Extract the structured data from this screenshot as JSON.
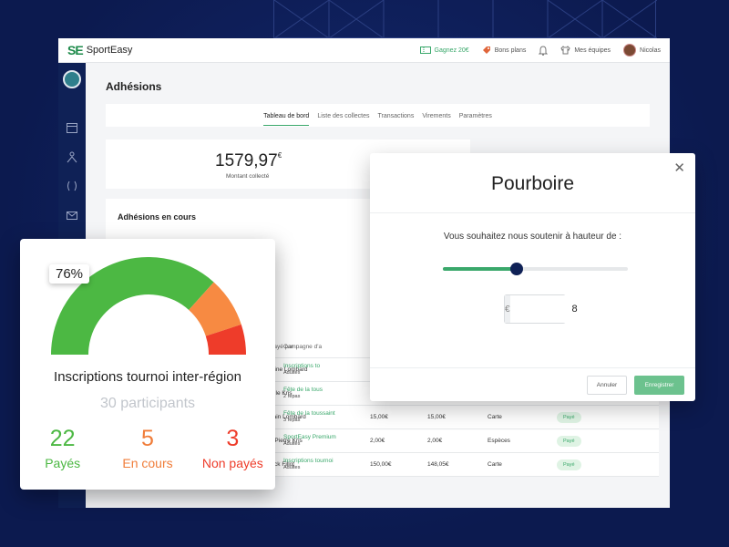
{
  "brand": {
    "logo_mark": "SE",
    "name": "SportEasy"
  },
  "topbar": {
    "earn_label": "Gagnez 20€",
    "deals_label": "Bons plans",
    "teams_label": "Mes équipes",
    "user_name": "Nicolas"
  },
  "page": {
    "title": "Adhésions",
    "tabs": [
      {
        "label": "Tableau de bord",
        "active": true
      },
      {
        "label": "Liste des collectes"
      },
      {
        "label": "Transactions"
      },
      {
        "label": "Virements"
      },
      {
        "label": "Paramètres"
      }
    ],
    "amount_value": "1579,97",
    "amount_currency": "€",
    "amount_label": "Montant collecté",
    "section_title": "Adhésions en cours"
  },
  "table": {
    "headers": [
      "Payé par",
      "Campagne d'a"
    ],
    "rows": [
      {
        "payer": "mine Lombard",
        "campaign": "Inscriptions to",
        "sub": "Adultes",
        "amount": "",
        "net": "",
        "method": "",
        "status": ""
      },
      {
        "payer": "eille Kris",
        "campaign": "Fête de la tous",
        "sub": "2 repas",
        "amount": "",
        "net": "",
        "method": "",
        "status": ""
      },
      {
        "payer": "nain Lombard",
        "campaign": "Fête de la toussaint",
        "sub": "3 repas",
        "amount": "15,00€",
        "net": "15,00€",
        "method": "Carte",
        "status": "Payé"
      },
      {
        "payer": "n Pierre Kris",
        "campaign": "SportEasy Premium",
        "sub": "Adultes",
        "amount": "2,00€",
        "net": "2,00€",
        "method": "Espèces",
        "status": "Payé"
      },
      {
        "payer": "nick Fillot",
        "campaign": "Inscriptions tournoi",
        "sub": "Adultes",
        "amount": "150,00€",
        "net": "148,05€",
        "method": "Carte",
        "status": "Payé"
      }
    ]
  },
  "gauge": {
    "percent_label": "76%",
    "title": "Inscriptions tournoi inter-région",
    "subtitle": "30 participants",
    "counts": [
      {
        "value": "22",
        "label": "Payés",
        "color": "#4cb843"
      },
      {
        "value": "5",
        "label": "En cours",
        "color": "#f07d3a"
      },
      {
        "value": "3",
        "label": "Non payés",
        "color": "#ee3c2a"
      }
    ]
  },
  "modal": {
    "title": "Pourboire",
    "prompt": "Vous souhaitez nous soutenir à hauteur de :",
    "slider_fraction": 0.4,
    "currency_symbol": "€",
    "amount": "8",
    "cancel_label": "Annuler",
    "save_label": "Enregistrer"
  },
  "colors": {
    "accent": "#3aa86b",
    "navy": "#0f2156"
  }
}
